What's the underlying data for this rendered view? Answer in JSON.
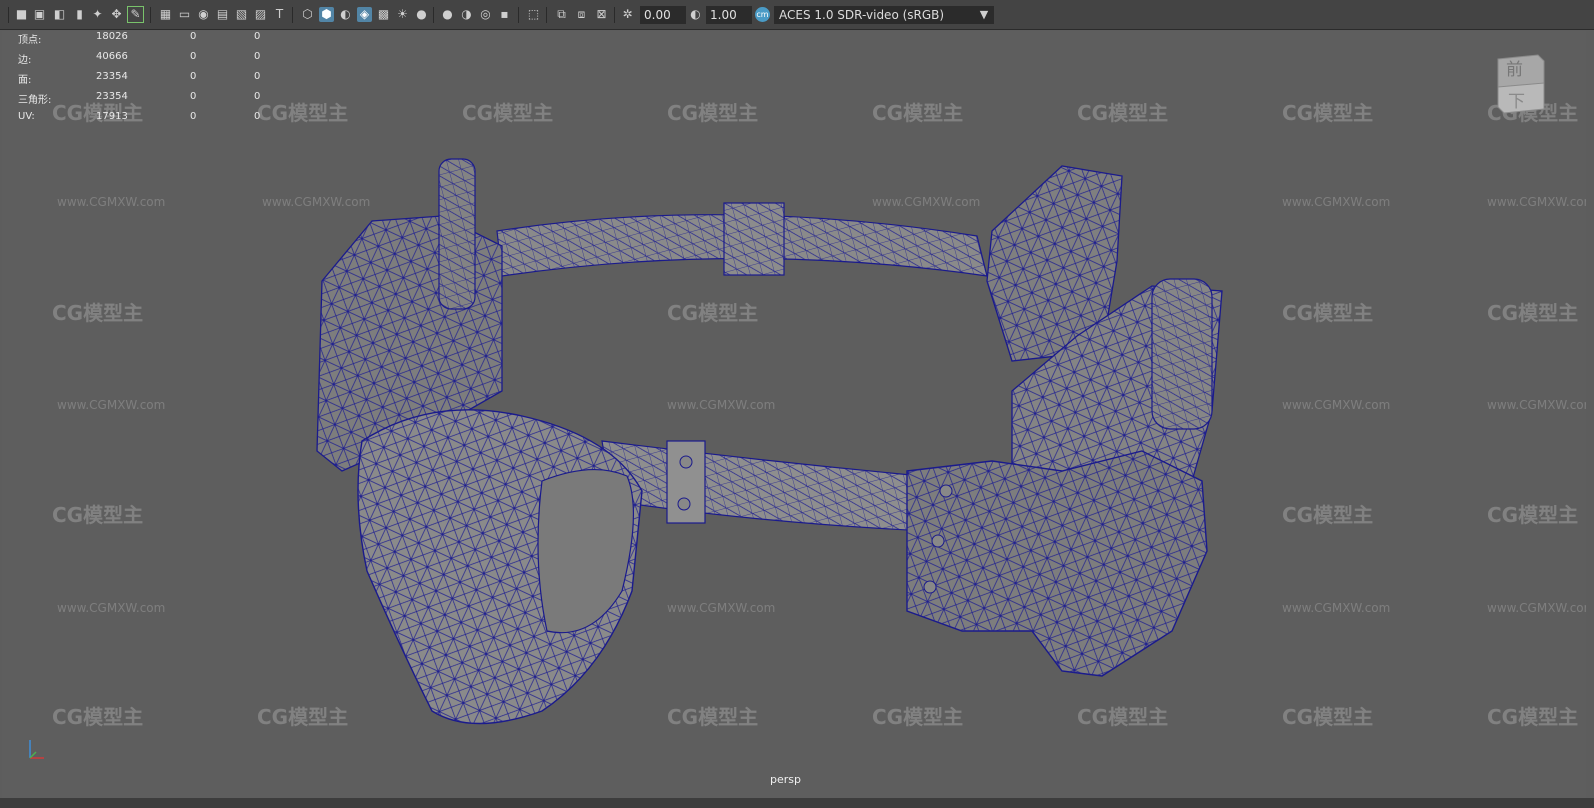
{
  "toolbar": {
    "exposure_value": "0.00",
    "gamma_value": "1.00",
    "color_management": "ACES 1.0 SDR-video (sRGB)",
    "icons": [
      "camera-icon",
      "camera-attributes-icon",
      "bookmark-icon",
      "image-plane-icon",
      "select-camera-icon",
      "grid-icon",
      "film-gate-icon",
      "resolution-gate-icon",
      "gate-mask-icon",
      "field-chart-icon",
      "safe-action-icon",
      "safe-title-icon",
      "wireframe-icon",
      "smooth-shade-icon",
      "flat-shade-icon",
      "wireframe-on-shaded-icon",
      "xray-icon",
      "lights-icon",
      "shadows-icon",
      "ambient-occlusion-icon",
      "motion-blur-icon",
      "anti-alias-icon",
      "isolate-select-icon",
      "xray-joints-icon",
      "exposure-icon",
      "gamma-icon",
      "color-management-icon"
    ]
  },
  "stats": {
    "rows": [
      {
        "label": "顶点:",
        "value": "18026",
        "a": "0",
        "b": "0"
      },
      {
        "label": "边:",
        "value": "40666",
        "a": "0",
        "b": "0"
      },
      {
        "label": "面:",
        "value": "23354",
        "a": "0",
        "b": "0"
      },
      {
        "label": "三角形:",
        "value": "23354",
        "a": "0",
        "b": "0"
      },
      {
        "label": "UV:",
        "value": "17913",
        "a": "0",
        "b": "0"
      }
    ]
  },
  "viewcube": {
    "front_label": "前",
    "bottom_label": "下"
  },
  "viewport": {
    "camera_label": "persp"
  },
  "watermark": {
    "logo": "CG模型主",
    "url": "www.CGMXW.com"
  },
  "colors": {
    "wireframe": "#1a1a8c",
    "mesh_fill": "#7a7a7a",
    "background": "#5e5e5e",
    "accent": "#5285a6"
  }
}
